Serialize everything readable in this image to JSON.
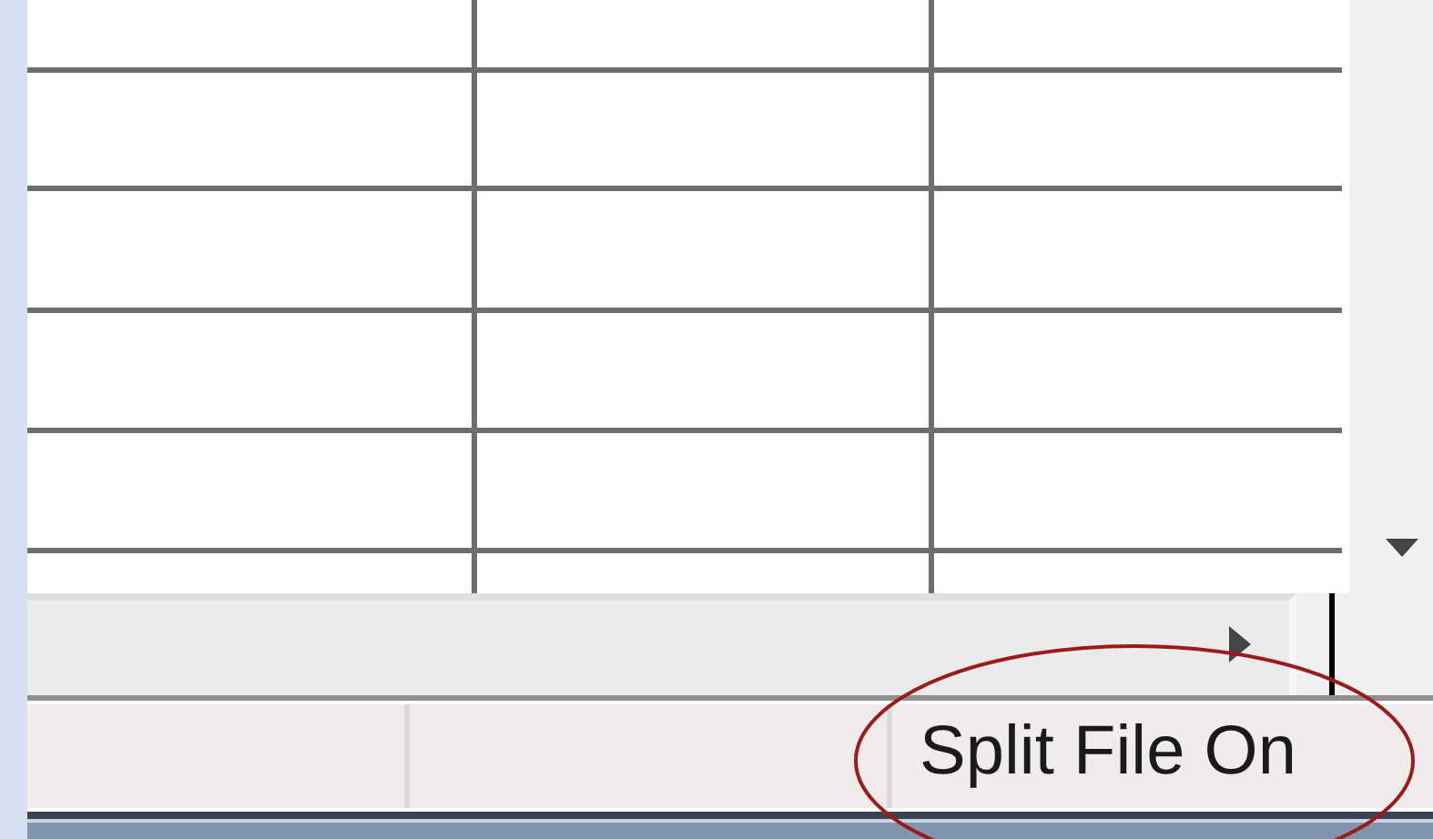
{
  "status_bar": {
    "split_file": "Split File On"
  }
}
